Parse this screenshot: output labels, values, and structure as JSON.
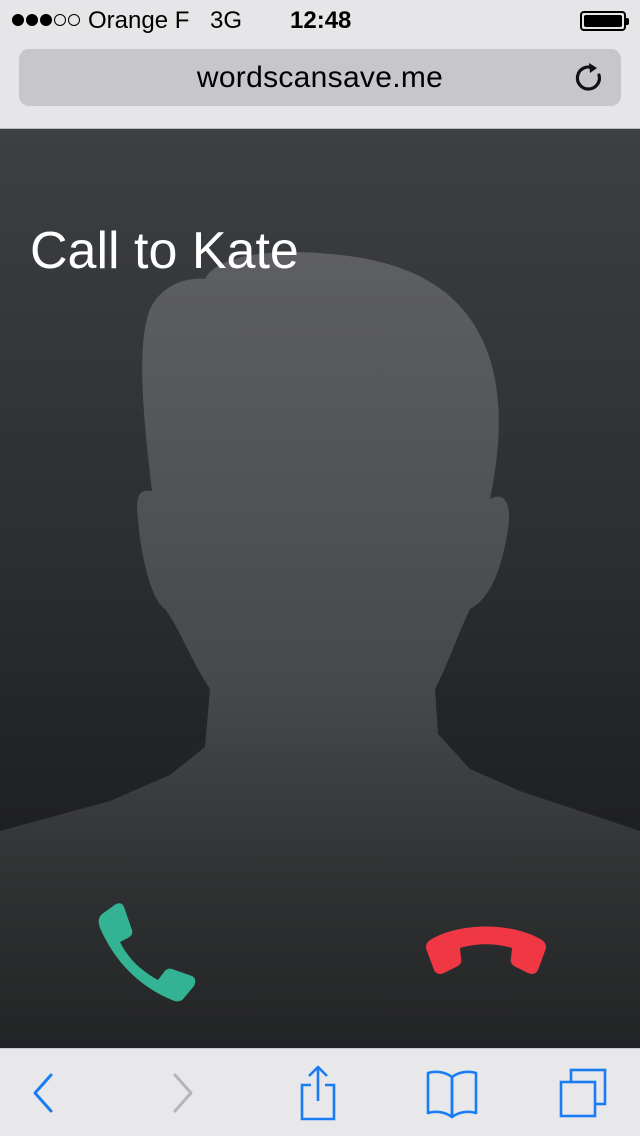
{
  "status_bar": {
    "signal_strength": "3 of 5",
    "carrier": "Orange F",
    "network": "3G",
    "time": "12:48",
    "battery_icon": "battery-full-icon"
  },
  "browser": {
    "url": "wordscansave.me",
    "reload_icon": "reload-icon"
  },
  "call": {
    "title": "Call to Kate",
    "accept_icon": "phone-accept-icon",
    "decline_icon": "phone-decline-icon",
    "accept_color": "#33b394",
    "decline_color": "#f03845"
  },
  "toolbar": {
    "items": [
      "back-icon",
      "forward-icon",
      "share-icon",
      "bookmarks-icon",
      "tabs-icon"
    ],
    "accent": "#1a7cf5",
    "disabled": "#b5b5b8"
  }
}
